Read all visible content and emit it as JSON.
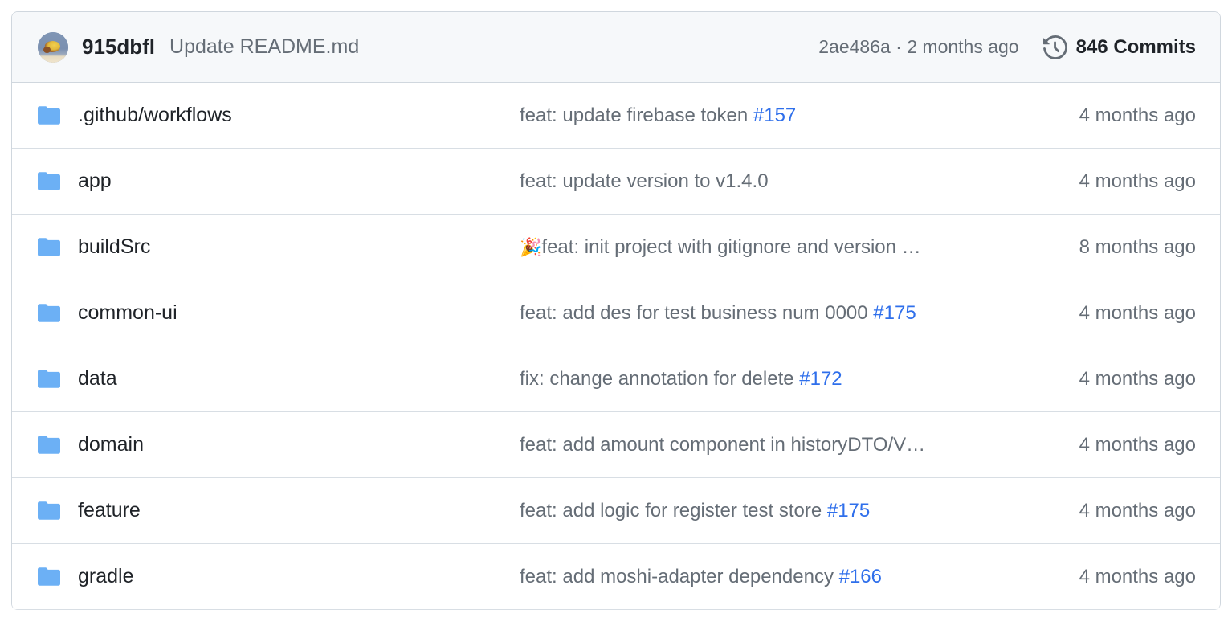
{
  "colors": {
    "link": "#2f6feb",
    "folder": "#6cb0f5",
    "header_bg": "#f6f8fa",
    "border": "#d0d7de",
    "text_primary": "#1f2328",
    "text_muted": "#656d76"
  },
  "commit_header": {
    "author": "915dbfl",
    "message": "Update README.md",
    "hash_and_time": "2ae486a · 2 months ago",
    "commit_count": "846 Commits",
    "history_icon": "history-icon",
    "avatar": "user-avatar"
  },
  "files": [
    {
      "icon": "folder-icon",
      "name": ".github/workflows",
      "commit_text": "feat: update firebase token ",
      "commit_link": "#157",
      "emoji": "",
      "truncated": "",
      "time": "4 months ago"
    },
    {
      "icon": "folder-icon",
      "name": "app",
      "commit_text": "feat: update version to v1.4.0",
      "commit_link": "",
      "emoji": "",
      "truncated": "",
      "time": "4 months ago"
    },
    {
      "icon": "folder-icon",
      "name": "buildSrc",
      "commit_text": "feat: init project with gitignore and version ",
      "commit_link": "",
      "emoji": "🎉",
      "truncated": "…",
      "time": "8 months ago"
    },
    {
      "icon": "folder-icon",
      "name": "common-ui",
      "commit_text": "feat: add des for test business num 0000 ",
      "commit_link": "#175",
      "emoji": "",
      "truncated": "",
      "time": "4 months ago"
    },
    {
      "icon": "folder-icon",
      "name": "data",
      "commit_text": "fix: change annotation for delete ",
      "commit_link": "#172",
      "emoji": "",
      "truncated": "",
      "time": "4 months ago"
    },
    {
      "icon": "folder-icon",
      "name": "domain",
      "commit_text": "feat: add amount component in historyDTO/V",
      "commit_link": "",
      "emoji": "",
      "truncated": "…",
      "time": "4 months ago"
    },
    {
      "icon": "folder-icon",
      "name": "feature",
      "commit_text": "feat: add logic for register test store ",
      "commit_link": "#175",
      "emoji": "",
      "truncated": "",
      "time": "4 months ago"
    },
    {
      "icon": "folder-icon",
      "name": "gradle",
      "commit_text": "feat: add moshi-adapter dependency ",
      "commit_link": "#166",
      "emoji": "",
      "truncated": "",
      "time": "4 months ago"
    }
  ]
}
